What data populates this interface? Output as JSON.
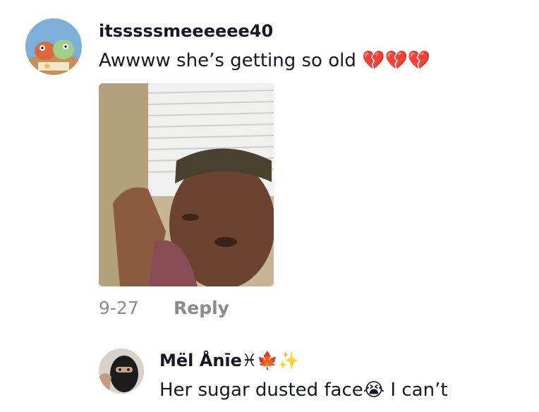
{
  "comment": {
    "username": "itsssssmeeeeee40",
    "text": "Awwww she’s getting so old 💔💔💔",
    "date": "9-27",
    "reply_label": "Reply",
    "avatar_icon": "spongebob-fish-cartoon-avatar",
    "photo_icon": "crying-woman-photo"
  },
  "reply": {
    "username": "Mël Ånīe♓🍁✨",
    "text": "Her sugar dusted face😭 I can’t",
    "avatar_icon": "person-in-black-mask-avatar"
  }
}
